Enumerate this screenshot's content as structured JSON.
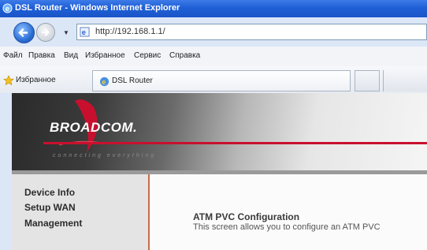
{
  "window": {
    "title": "DSL Router - Windows Internet Explorer"
  },
  "address": {
    "url": "http://192.168.1.1/"
  },
  "menu": {
    "items": [
      "Файл",
      "Правка",
      "Вид",
      "Избранное",
      "Сервис",
      "Справка"
    ]
  },
  "favorites": {
    "label": "Избранное"
  },
  "tab": {
    "label": "DSL Router"
  },
  "banner": {
    "logo": "BROADCOM.",
    "tagline": "connecting everything",
    "accent_color": "#c8102e"
  },
  "sidebar": {
    "items": [
      "Device Info",
      "Setup WAN",
      "Management"
    ]
  },
  "content": {
    "heading": "ATM PVC Configuration",
    "description": "This screen allows you to configure an ATM PVC"
  }
}
